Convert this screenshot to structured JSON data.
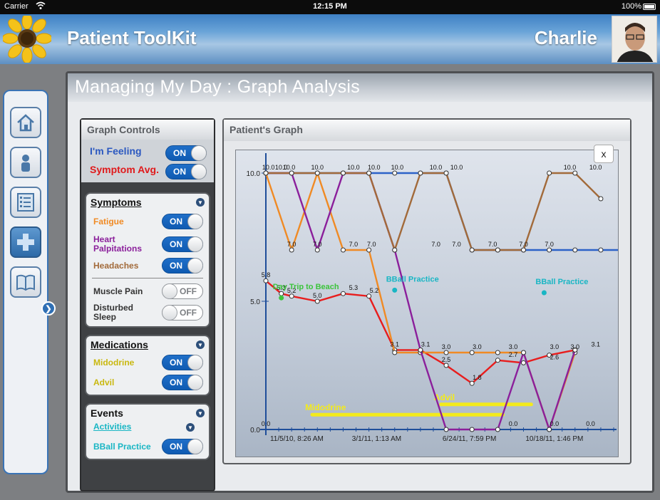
{
  "status_bar": {
    "carrier": "Carrier",
    "time": "12:15 PM",
    "battery": "100%"
  },
  "header": {
    "app_title": "Patient ToolKit",
    "user_name": "Charlie"
  },
  "page": {
    "title": "Managing My Day : Graph Analysis"
  },
  "graph_controls": {
    "title": "Graph Controls",
    "im_feeling": {
      "label": "I'm Feeling",
      "state": "ON"
    },
    "symptom_avg": {
      "label": "Symptom Avg.",
      "state": "ON"
    },
    "symptoms": {
      "title": "Symptoms",
      "items": [
        {
          "label": "Fatigue",
          "state": "ON",
          "color": "#f08a24"
        },
        {
          "label": "Heart Palpitations",
          "state": "ON",
          "color": "#8b1f9b"
        },
        {
          "label": "Headaches",
          "state": "ON",
          "color": "#a26a3a"
        },
        {
          "label": "Muscle Pain",
          "state": "OFF",
          "color": "#333333"
        },
        {
          "label": "Disturbed Sleep",
          "state": "OFF",
          "color": "#333333"
        }
      ]
    },
    "medications": {
      "title": "Medications",
      "items": [
        {
          "label": "Midodrine",
          "state": "ON",
          "color": "#c9b80f"
        },
        {
          "label": "Advil",
          "state": "ON",
          "color": "#c9b80f"
        }
      ]
    },
    "events": {
      "title": "Events",
      "activities_label": "Activities",
      "items": [
        {
          "label": "BBall Practice",
          "state": "ON",
          "color": "#19b6c4"
        }
      ]
    }
  },
  "patients_graph": {
    "title": "Patient's Graph",
    "close_label": "x"
  },
  "chart_data": {
    "type": "line",
    "y_ticks": [
      "0.0",
      "5.0",
      "10.0"
    ],
    "x_tick_labels": [
      "11/5/10, 8:26 AM",
      "3/1/11, 1:13 AM",
      "6/24/11, 7:59 PM",
      "10/18/11, 1:46 PM"
    ],
    "ylim": [
      0,
      10
    ],
    "series": [
      {
        "name": "I'm Feeling",
        "color": "#2d62c8",
        "points": [
          [
            0,
            10
          ],
          [
            1,
            10
          ],
          [
            2,
            10
          ],
          [
            3,
            10
          ],
          [
            4,
            10
          ],
          [
            5,
            10
          ],
          [
            6,
            10
          ],
          [
            7,
            10
          ],
          [
            8,
            7
          ],
          [
            9,
            7
          ],
          [
            10,
            7
          ],
          [
            11,
            7
          ],
          [
            12,
            7
          ],
          [
            13,
            7
          ],
          [
            14,
            7
          ]
        ]
      },
      {
        "name": "Symptom Avg.",
        "color": "#e81d1d",
        "points": [
          [
            0,
            5.8
          ],
          [
            0.6,
            5.3
          ],
          [
            1,
            5.2
          ],
          [
            2,
            5.0
          ],
          [
            3,
            5.3
          ],
          [
            4,
            5.2
          ],
          [
            5,
            3.1
          ],
          [
            6,
            3.1
          ],
          [
            7,
            2.5
          ],
          [
            8,
            1.8
          ],
          [
            9,
            2.7
          ],
          [
            10,
            2.6
          ],
          [
            11,
            2.9
          ],
          [
            12,
            3.1
          ]
        ]
      },
      {
        "name": "Fatigue",
        "color": "#f08a24",
        "points": [
          [
            0,
            10
          ],
          [
            1,
            7
          ],
          [
            2,
            10
          ],
          [
            3,
            7
          ],
          [
            4,
            7
          ],
          [
            5,
            3.0
          ],
          [
            6,
            3.0
          ],
          [
            7,
            3.0
          ],
          [
            8,
            3.0
          ],
          [
            9,
            3.0
          ],
          [
            10,
            3.0
          ],
          [
            11,
            0
          ],
          [
            12,
            3.0
          ]
        ]
      },
      {
        "name": "Heart Palpitations",
        "color": "#8b1f9b",
        "points": [
          [
            0,
            10
          ],
          [
            1,
            10
          ],
          [
            2,
            7
          ],
          [
            3,
            10
          ],
          [
            4,
            10
          ],
          [
            5,
            7
          ],
          [
            6,
            3.1
          ],
          [
            7,
            0
          ],
          [
            8,
            0
          ],
          [
            9,
            0
          ],
          [
            10,
            3.0
          ],
          [
            11,
            0
          ],
          [
            12,
            3.1
          ]
        ]
      },
      {
        "name": "Headaches",
        "color": "#a26a3a",
        "points": [
          [
            0,
            10
          ],
          [
            1,
            10
          ],
          [
            2,
            10
          ],
          [
            3,
            10
          ],
          [
            4,
            10
          ],
          [
            5,
            7
          ],
          [
            6,
            10
          ],
          [
            7,
            10
          ],
          [
            8,
            7
          ],
          [
            9,
            7
          ],
          [
            10,
            7
          ],
          [
            11,
            10
          ],
          [
            12,
            10
          ],
          [
            13,
            9
          ]
        ]
      }
    ],
    "events": [
      {
        "label": "Day Trip to Beach",
        "color": "#3cc43c",
        "x": 0.6,
        "y": 5.3
      },
      {
        "label": "BBall Practice",
        "color": "#19b6c4",
        "x": 5,
        "y": 5.6
      },
      {
        "label": "BBall Practice",
        "color": "#19b6c4",
        "x": 10.8,
        "y": 5.5
      }
    ],
    "medications": [
      {
        "label": "Midodrine",
        "color": "#f3ea1c",
        "x_start": 1.8,
        "x_end": 9.2,
        "y": 0.3
      },
      {
        "label": "Advil",
        "color": "#f3ea1c",
        "x_start": 6.8,
        "x_end": 10.3,
        "y": 0.7
      }
    ],
    "value_labels": [
      [
        "10.0",
        0.1,
        10
      ],
      [
        "10.0",
        0.6,
        10
      ],
      [
        "10.0",
        0.9,
        10
      ],
      [
        "10.0",
        2,
        10
      ],
      [
        "10.0",
        3.4,
        10
      ],
      [
        "10.0",
        4.2,
        10
      ],
      [
        "10.0",
        5.1,
        10
      ],
      [
        "10.0",
        6.6,
        10
      ],
      [
        "10.0",
        7.4,
        10
      ],
      [
        "10.0",
        11.8,
        10
      ],
      [
        "10.0",
        12.8,
        10
      ],
      [
        "7.0",
        1,
        7
      ],
      [
        "7.0",
        2,
        7
      ],
      [
        "7.0",
        3.4,
        7
      ],
      [
        "7.0",
        4.1,
        7
      ],
      [
        "7.0",
        6.6,
        7
      ],
      [
        "7.0",
        7.4,
        7
      ],
      [
        "7.0",
        8.8,
        7
      ],
      [
        "7.0",
        10,
        7
      ],
      [
        "7.0",
        11,
        7
      ],
      [
        "5.8",
        0,
        5.8
      ],
      [
        "5.3",
        0.6,
        5.3
      ],
      [
        "5.2",
        1,
        5.2
      ],
      [
        "5.0",
        2,
        5.0
      ],
      [
        "5.3",
        3.4,
        5.3
      ],
      [
        "5.2",
        4.2,
        5.2
      ],
      [
        "3.1",
        5,
        3.1
      ],
      [
        "3.1",
        6.2,
        3.1
      ],
      [
        "3.0",
        7,
        3.0
      ],
      [
        "3.0",
        8.2,
        3.0
      ],
      [
        "3.0",
        9.6,
        3.0
      ],
      [
        "3.0",
        11.2,
        3.0
      ],
      [
        "3.0",
        12,
        3.0
      ],
      [
        "3.1",
        12.8,
        3.1
      ],
      [
        "2.5",
        7,
        2.5
      ],
      [
        "2.7",
        9.6,
        2.7
      ],
      [
        "2.6",
        11.2,
        2.6
      ],
      [
        "1.8",
        8.2,
        1.8
      ],
      [
        "0.0",
        0,
        0
      ],
      [
        "0.0",
        9.6,
        0
      ],
      [
        "0.0",
        11.2,
        0
      ],
      [
        "0.0",
        12.6,
        0
      ]
    ]
  }
}
